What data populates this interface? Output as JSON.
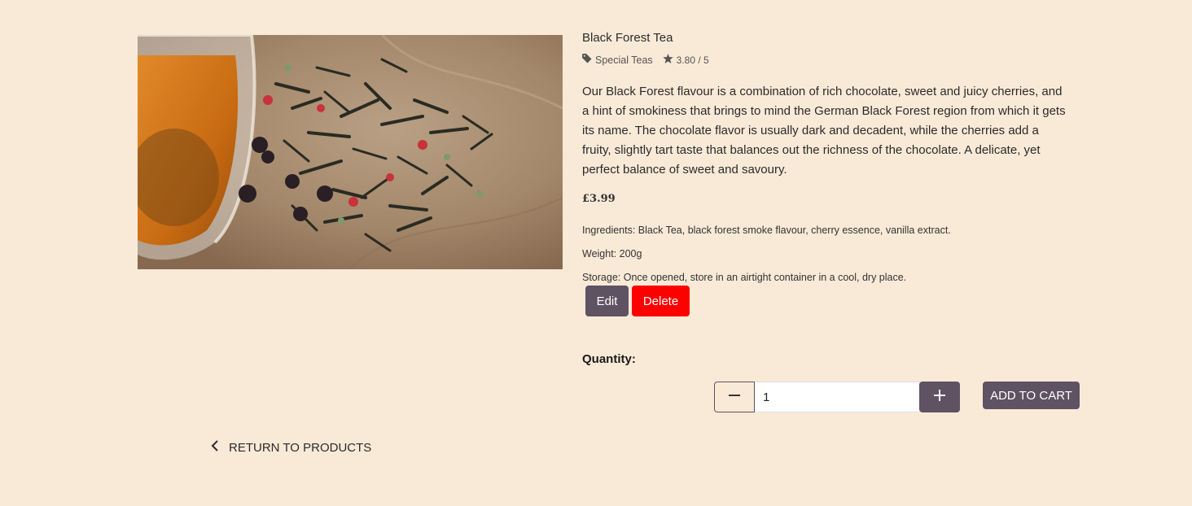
{
  "product": {
    "title": "Black Forest Tea",
    "category": "Special Teas",
    "rating": "3.80 / 5",
    "description": "Our Black Forest flavour is a combination of rich chocolate, sweet and juicy cherries, and a hint of smokiness that brings to mind the German Black Forest region from which it gets its name. The chocolate flavor is usually dark and decadent, while the cherries add a fruity, slightly tart taste that balances out the richness of the chocolate. A delicate, yet perfect balance of sweet and savoury.",
    "price": "£3.99",
    "ingredients": "Ingredients: Black Tea, black forest smoke flavour, cherry essence, vanilla extract.",
    "weight": "Weight: 200g",
    "storage": "Storage: Once opened, store in an airtight container in a cool, dry place."
  },
  "actions": {
    "edit_label": "Edit",
    "delete_label": "Delete"
  },
  "quantity": {
    "label": "Quantity:",
    "value": "1"
  },
  "cart": {
    "add_label": "ADD TO CART"
  },
  "nav": {
    "return_label": "RETURN TO PRODUCTS"
  },
  "icons": {
    "tag": "tag-icon",
    "star": "star-icon",
    "minus": "minus-icon",
    "plus": "plus-icon",
    "chevron": "chevron-left-icon"
  },
  "colors": {
    "background": "#f9ead7",
    "primary": "#5f5263",
    "danger": "#ff0000"
  }
}
